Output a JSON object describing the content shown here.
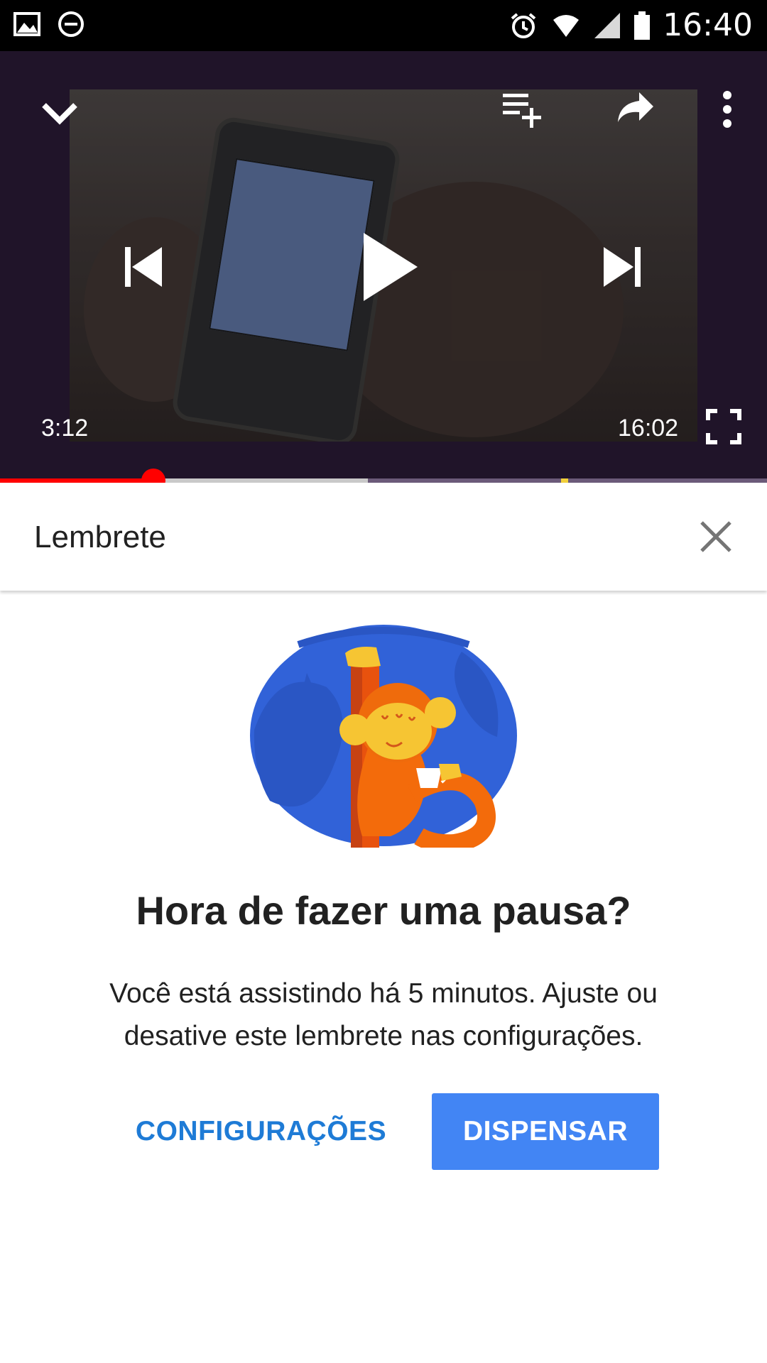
{
  "status_bar": {
    "time": "16:40",
    "left_icons": [
      "image-icon",
      "do-not-disturb-icon"
    ],
    "right_icons": [
      "alarm-icon",
      "wifi-icon",
      "signal-icon",
      "battery-icon"
    ]
  },
  "player": {
    "current_time": "3:12",
    "duration": "16:02",
    "progress_fraction": 0.2,
    "buffered_fraction": 0.48,
    "controls": [
      "chevron-down-icon",
      "add-to-playlist-icon",
      "share-icon",
      "more-vert-icon",
      "skip-previous-icon",
      "play-icon",
      "skip-next-icon",
      "fullscreen-icon"
    ]
  },
  "reminder": {
    "header_title": "Lembrete",
    "headline": "Hora de fazer uma pausa?",
    "body": "Você está assistindo há 5 minutos. Ajuste ou desative este lembrete nas configurações.",
    "settings_label": "CONFIGURAÇÕES",
    "dismiss_label": "DISPENSAR"
  },
  "colors": {
    "accent_blue": "#4285f4",
    "link_blue": "#1e7bd6",
    "progress_red": "#ff0000",
    "player_bg": "#201429"
  }
}
